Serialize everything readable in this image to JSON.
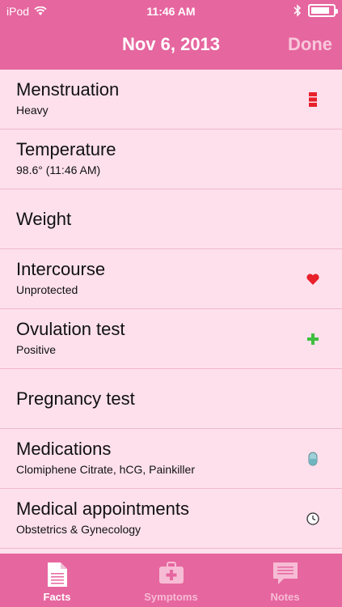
{
  "status": {
    "carrier": "iPod",
    "time": "11:46 AM",
    "battery_level": 0.85,
    "icons": [
      "wifi-icon",
      "bluetooth-icon",
      "battery-icon"
    ]
  },
  "nav": {
    "title": "Nov 6, 2013",
    "done_label": "Done"
  },
  "rows": [
    {
      "title": "Menstruation",
      "subtitle": "Heavy",
      "icon": "flow-heavy-icon"
    },
    {
      "title": "Temperature",
      "subtitle": "98.6° (11:46 AM)",
      "icon": ""
    },
    {
      "title": "Weight",
      "subtitle": "",
      "icon": ""
    },
    {
      "title": "Intercourse",
      "subtitle": "Unprotected",
      "icon": "heart-icon"
    },
    {
      "title": "Ovulation test",
      "subtitle": "Positive",
      "icon": "plus-icon"
    },
    {
      "title": "Pregnancy test",
      "subtitle": "",
      "icon": ""
    },
    {
      "title": "Medications",
      "subtitle": "Clomiphene Citrate, hCG, Painkiller",
      "icon": "pill-icon"
    },
    {
      "title": "Medical appointments",
      "subtitle": "Obstetrics & Gynecology",
      "icon": "clock-icon"
    }
  ],
  "tabs": [
    {
      "label": "Facts",
      "icon": "document-icon",
      "active": true
    },
    {
      "label": "Symptoms",
      "icon": "medkit-icon",
      "active": false
    },
    {
      "label": "Notes",
      "icon": "speech-bubble-icon",
      "active": false
    }
  ],
  "colors": {
    "accent": "#e6669f",
    "background": "#fde0ec",
    "flow_red": "#e8202a",
    "heart_red": "#e8202a",
    "plus_green": "#3fbf3f"
  }
}
